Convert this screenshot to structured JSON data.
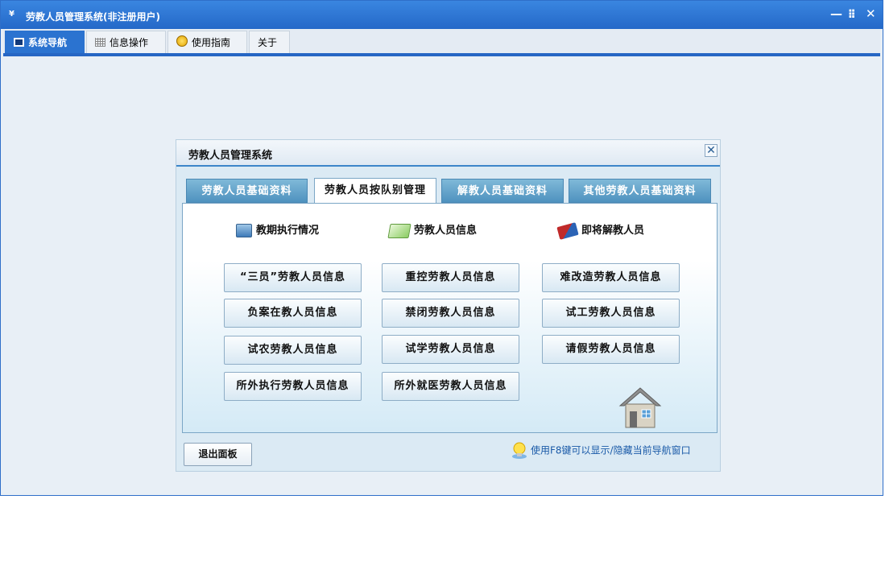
{
  "window": {
    "title": "劳教人员管理系统(非注册用户)",
    "controls": {
      "minimize": "—",
      "restore": "⁝⁝",
      "close": "✕"
    }
  },
  "menu": [
    {
      "label": "系统导航",
      "icon": "nav-icon",
      "active": true
    },
    {
      "label": "信息操作",
      "icon": "grid-icon",
      "active": false
    },
    {
      "label": "使用指南",
      "icon": "guide-icon",
      "active": false
    },
    {
      "label": "关于",
      "icon": "",
      "active": false
    }
  ],
  "dialog": {
    "title": "劳教人员管理系统",
    "close": "✕",
    "tabs": [
      {
        "label": "劳教人员基础资料",
        "active": false
      },
      {
        "label": "劳教人员按队别管理",
        "active": true
      },
      {
        "label": "解教人员基础资料",
        "active": false
      },
      {
        "label": "其他劳教人员基础资料",
        "active": false
      }
    ],
    "sections": [
      {
        "label": "教期执行情况",
        "icon": "monitor-icon"
      },
      {
        "label": "劳教人员信息",
        "icon": "card-icon"
      },
      {
        "label": "即将解教人员",
        "icon": "book-icon"
      }
    ],
    "buttons": [
      "“三员”劳教人员信息",
      "重控劳教人员信息",
      "难改造劳教人员信息",
      "负案在教人员信息",
      "禁闭劳教人员信息",
      "试工劳教人员信息",
      "试农劳教人员信息",
      "试学劳教人员信息",
      "请假劳教人员信息",
      "所外执行劳教人员信息",
      "所外就医劳教人员信息"
    ],
    "exit_label": "退出面板",
    "hint": "使用F8键可以显示/隐藏当前导航窗口",
    "colors": {
      "accent": "#2666c4",
      "tab": "#5b9ac6",
      "panel_bg": "#dbeaf4"
    }
  }
}
